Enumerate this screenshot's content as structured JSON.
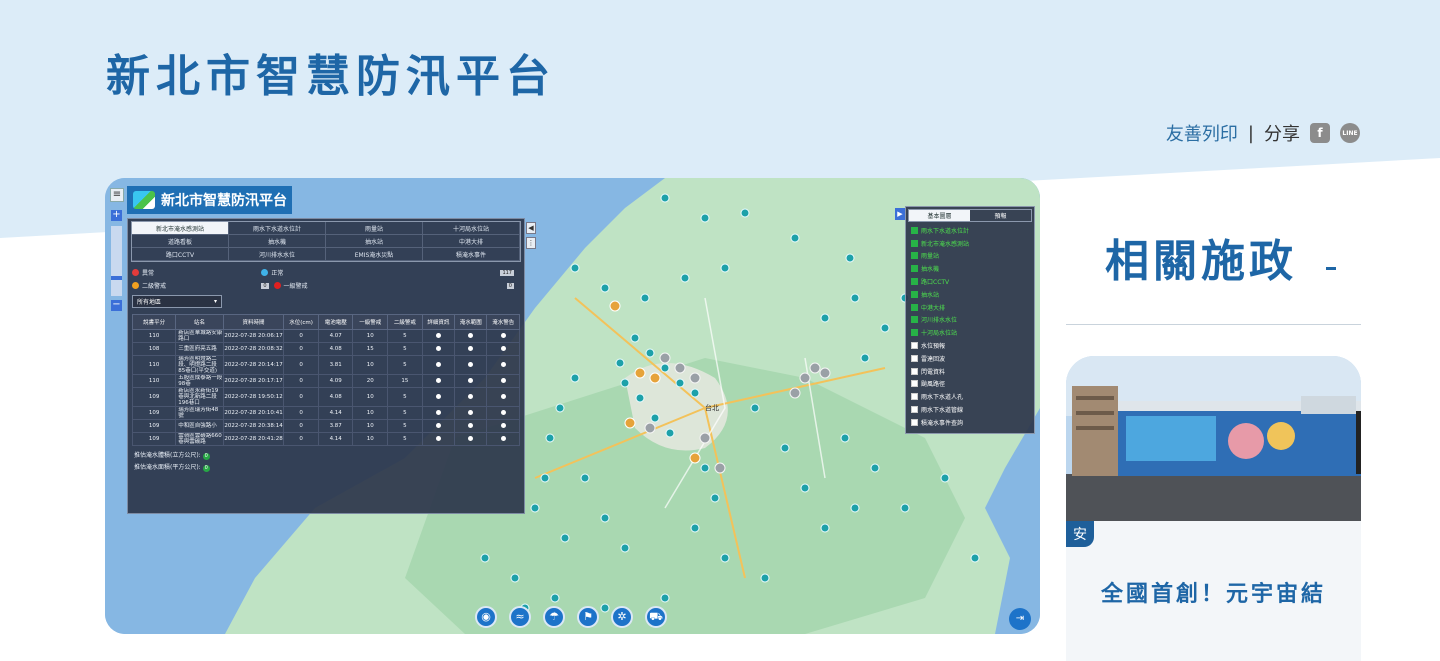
{
  "header": {
    "title": "新北市智慧防汛平台",
    "print_label": "友善列印",
    "separator": "|",
    "share_label": "分享",
    "facebook_icon_text": "f",
    "line_icon_text": "LINE"
  },
  "map_app": {
    "logo_text": "新北市智慧防汛平台",
    "tabs": [
      "新北市淹水感測站",
      "雨水下水道水位計",
      "雨量站",
      "十河局水位站",
      "道路看板",
      "抽水機",
      "抽水站",
      "中港大排",
      "路口CCTV",
      "河川排水水位",
      "EMIS淹水災點",
      "積淹水事件"
    ],
    "legend": [
      {
        "label": "異常",
        "color": "#e23b3b",
        "count": ""
      },
      {
        "label": "正常",
        "color": "#3fb2e8",
        "count": "117"
      },
      {
        "label": "",
        "color": "",
        "count": ""
      },
      {
        "label": "二級警戒",
        "color": "#f0a020",
        "count": "0"
      },
      {
        "label": "一級警戒",
        "color": "#e02020",
        "count": "0"
      },
      {
        "label": "",
        "color": "",
        "count": ""
      }
    ],
    "district_select": "所有地區",
    "table_headers": [
      "說書平分",
      "站名",
      "資料時間",
      "水位(cm)",
      "電池電壓",
      "一級警戒",
      "二級警戒",
      "詳細資訊",
      "淹水範圍",
      "淹水警告"
    ],
    "rows": [
      [
        "110",
        "新店區華城路安康路口",
        "2022-07-28 20:06:17",
        "0",
        "4.07",
        "10",
        "5"
      ],
      [
        "108",
        "三重區府亮五路",
        "2022-07-28 20:08:32",
        "0",
        "4.08",
        "15",
        "5"
      ],
      [
        "110",
        "瑞芳區明燈路二段、明燈路二段85巷口(平交道)",
        "2022-07-28 20:14:17",
        "0",
        "3.81",
        "10",
        "5"
      ],
      [
        "110",
        "五股區成泰路一段98巷",
        "2022-07-28 20:17:17",
        "0",
        "4.09",
        "20",
        "15"
      ],
      [
        "109",
        "新店區永新街19巷與北新路二段196巷口",
        "2022-07-28 19:50:12",
        "0",
        "4.08",
        "10",
        "5"
      ],
      [
        "109",
        "瑞芳區瑞芳街48號",
        "2022-07-28 20:10:41",
        "0",
        "4.14",
        "10",
        "5"
      ],
      [
        "109",
        "中和區自強路小",
        "2022-07-28 20:38:14",
        "0",
        "3.87",
        "10",
        "5"
      ],
      [
        "109",
        "雲嶺區雲碳路660巷與雲碳路",
        "2022-07-28 20:41:28",
        "0",
        "4.14",
        "10",
        "5"
      ]
    ],
    "footer_volume": "推估淹水體積(立方公尺):",
    "footer_area": "推估淹水面積(平方公尺):",
    "footer_volume_value": "0",
    "footer_area_value": "0",
    "layer_tabs": [
      "基本圖層",
      "預報"
    ],
    "layers": [
      {
        "label": "雨水下水道水位計",
        "on": true
      },
      {
        "label": "新北市淹水感測站",
        "on": true
      },
      {
        "label": "雨量站",
        "on": true
      },
      {
        "label": "抽水機",
        "on": true
      },
      {
        "label": "路口CCTV",
        "on": true
      },
      {
        "label": "抽水站",
        "on": true
      },
      {
        "label": "中港大排",
        "on": true
      },
      {
        "label": "河川排水水位",
        "on": true
      },
      {
        "label": "十河局水位站",
        "on": true
      },
      {
        "label": "水位預報",
        "on": false
      },
      {
        "label": "雷達回波",
        "on": false
      },
      {
        "label": "閃電資料",
        "on": false
      },
      {
        "label": "颱風路徑",
        "on": false
      },
      {
        "label": "雨水下水道人孔",
        "on": false
      },
      {
        "label": "雨水下水道管線",
        "on": false
      },
      {
        "label": "積淹水事件查詢",
        "on": false
      }
    ],
    "map_labels": {
      "city": "台北"
    }
  },
  "sidebar": {
    "title": "相關施政",
    "card_tag": "安",
    "card_title": "全國首創！元宇宙結"
  },
  "colors": {
    "brand_blue": "#1e66a6",
    "hero_bg": "#dcecf8",
    "panel_bg": "#2d374b"
  }
}
